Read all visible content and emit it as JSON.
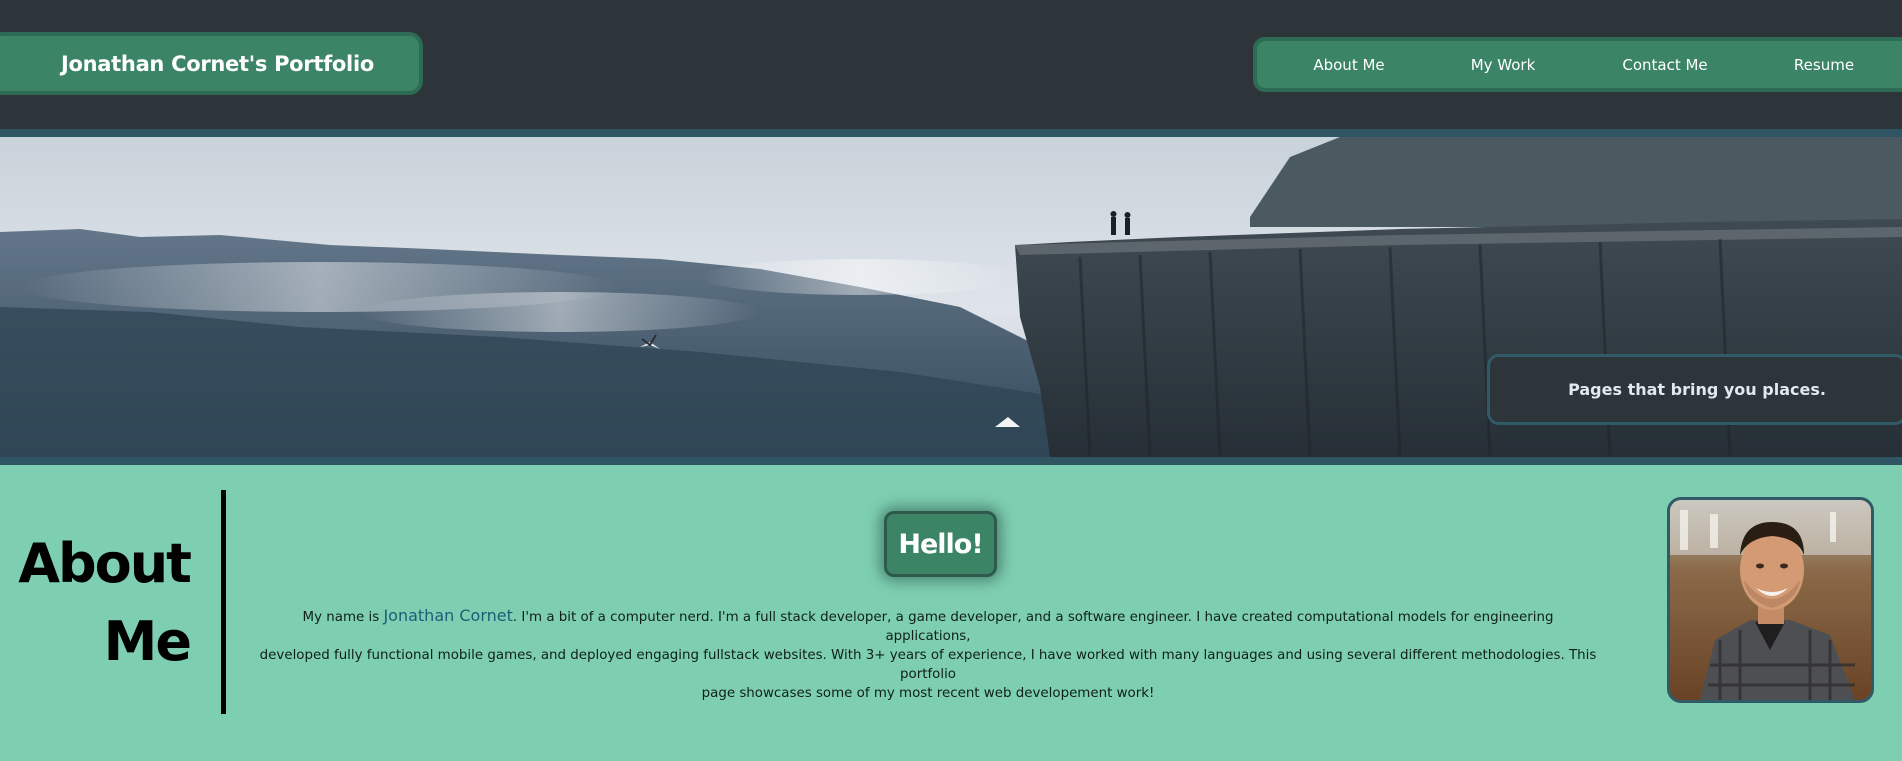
{
  "header": {
    "brand_title": "Jonathan Cornet's Portfolio",
    "nav": [
      {
        "label": "About Me"
      },
      {
        "label": "My Work"
      },
      {
        "label": "Contact Me"
      },
      {
        "label": "Resume"
      }
    ]
  },
  "hero": {
    "tagline": "Pages that bring you places."
  },
  "about": {
    "heading_line1": "About",
    "heading_line2": "Me",
    "hello": "Hello!",
    "bio_prefix": "My name is ",
    "bio_name": "Jonathan Cornet",
    "bio_line1_rest": ". I'm a bit of a computer nerd. I'm a full stack developer, a game developer, and a software engineer. I have created computational models for engineering applications,",
    "bio_line2": "developed fully functional mobile games, and deployed engaging fullstack websites. With 3+ years of experience, I have worked with many languages and using several different methodologies. This portfolio",
    "bio_line3": "page showcases some of my most recent web developement work!"
  },
  "colors": {
    "header_bg": "#2d353a",
    "accent_green": "#3b8466",
    "about_bg": "#7ecfb1",
    "border_teal": "#2f5563"
  }
}
